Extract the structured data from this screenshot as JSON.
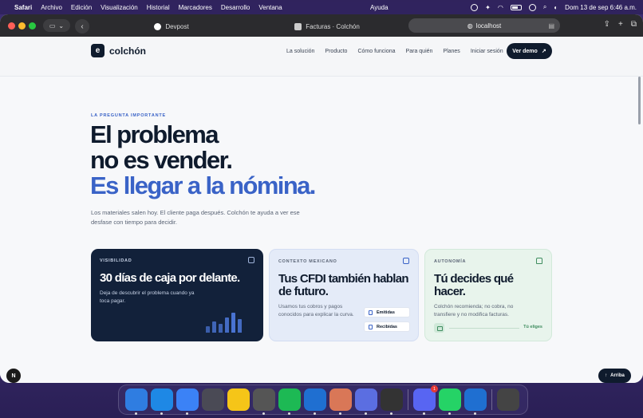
{
  "menubar": {
    "app": "Safari",
    "items": [
      "Archivo",
      "Edición",
      "Visualización",
      "Historial",
      "Marcadores",
      "Desarrollo",
      "Ventana"
    ],
    "center": "Ayuda",
    "clock": "Dom 13 de sep  6:46 a.m."
  },
  "browser": {
    "tabs": [
      {
        "label": "Devpost"
      },
      {
        "label": "Facturas · Colchón"
      }
    ],
    "url": "localhost"
  },
  "site": {
    "logo": "colchón",
    "nav": [
      "La solución",
      "Producto",
      "Cómo funciona",
      "Para quién",
      "Planes",
      "Iniciar sesión"
    ],
    "cta": "Ver demo",
    "cta_arrow": "↗",
    "eyebrow": "LA PREGUNTA IMPORTANTE",
    "headline": {
      "line1": "El problema",
      "line2": "no es vender.",
      "line3": "Es llegar a la nómina."
    },
    "lede": "Los materiales salen hoy. El cliente paga después. Colchón te ayuda a ver ese desfase con tiempo para decidir.",
    "cards": [
      {
        "tag": "VISIBILIDAD",
        "title": "30 días de caja por delante.",
        "body": "Deja de descubrir el problema cuando ya toca pagar.",
        "bars": [
          0.28,
          0.45,
          0.38,
          0.62,
          0.82,
          0.58
        ]
      },
      {
        "tag": "CONTEXTO MEXICANO",
        "title": "Tus CFDI también hablan de futuro.",
        "body": "Usamos tus cobros y pagos conocidos para explicar la curva.",
        "chips": [
          "Emitidas",
          "Recibidas"
        ]
      },
      {
        "tag": "AUTONOMÍA",
        "title": "Tú decides qué hacer.",
        "body": "Colchón recomienda; no cobra, no transfiere y no modifica facturas.",
        "choice": "Tú eliges"
      }
    ],
    "n_badge": "N",
    "back_to_top": "Arriba",
    "back_to_top_arrow": "↑"
  },
  "dock": {
    "apps": [
      {
        "name": "finder",
        "color": "#2f7de1"
      },
      {
        "name": "safari",
        "color": "#1e88e5"
      },
      {
        "name": "mail",
        "color": "#3b82f6"
      },
      {
        "name": "launchpad",
        "color": "#4a4a55"
      },
      {
        "name": "notes",
        "color": "#f5c518"
      },
      {
        "name": "chrome",
        "color": "#555"
      },
      {
        "name": "spotify",
        "color": "#1db954"
      },
      {
        "name": "vscode",
        "color": "#1f6fd1"
      },
      {
        "name": "claude",
        "color": "#d97757"
      },
      {
        "name": "proton-vpn",
        "color": "#5b6ee1"
      },
      {
        "name": "cursor",
        "color": "#333"
      },
      {
        "name": "discord",
        "color": "#5865f2",
        "badge": "1"
      },
      {
        "name": "whatsapp",
        "color": "#25d366"
      },
      {
        "name": "vscode-2",
        "color": "#1f6fd1"
      },
      {
        "name": "trash",
        "color": "#444"
      }
    ]
  }
}
